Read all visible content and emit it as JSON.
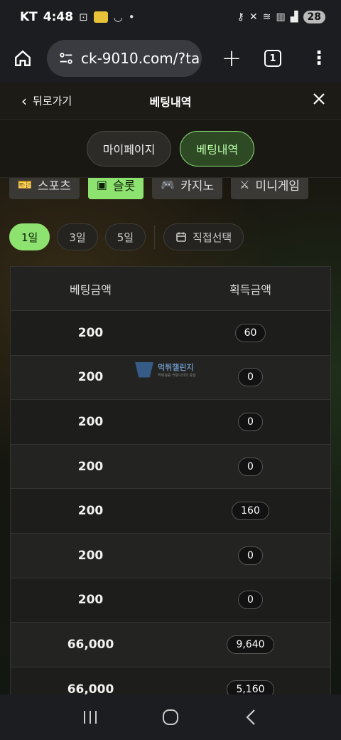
{
  "status_bar": {
    "carrier": "KT",
    "time": "4:48",
    "battery": "28",
    "dot": "•"
  },
  "browser": {
    "url": "ck-9010.com/?ta",
    "tabs_count": "1"
  },
  "header": {
    "back_label": "뒤로가기",
    "title": "베팅내역"
  },
  "tabs": [
    {
      "label": "마이페이지",
      "active": false
    },
    {
      "label": "베팅내역",
      "active": true
    }
  ],
  "categories": [
    {
      "label": "스포츠",
      "icon": "ticket-icon",
      "active": false
    },
    {
      "label": "슬롯",
      "icon": "slot-icon",
      "active": true
    },
    {
      "label": "카지노",
      "icon": "gamepad-icon",
      "active": false
    },
    {
      "label": "미니게임",
      "icon": "swords-icon",
      "active": false
    }
  ],
  "periods": [
    {
      "label": "1일",
      "active": true
    },
    {
      "label": "3일",
      "active": false
    },
    {
      "label": "5일",
      "active": false
    }
  ],
  "custom_period_label": "직접선택",
  "table": {
    "headers": [
      "베팅금액",
      "획득금액"
    ],
    "rows": [
      {
        "bet": "200",
        "won": "60"
      },
      {
        "bet": "200",
        "won": "0"
      },
      {
        "bet": "200",
        "won": "0"
      },
      {
        "bet": "200",
        "won": "0"
      },
      {
        "bet": "200",
        "won": "160"
      },
      {
        "bet": "200",
        "won": "0"
      },
      {
        "bet": "200",
        "won": "0"
      },
      {
        "bet": "66,000",
        "won": "9,640"
      },
      {
        "bet": "66,000",
        "won": "5,160"
      }
    ]
  },
  "watermark": {
    "title": "먹튀챌린지",
    "subtitle": "먹튀검증 커뮤니티의 중심"
  },
  "colors": {
    "accent_green": "#8ee26f",
    "active_tab_border": "#8fe07a"
  }
}
